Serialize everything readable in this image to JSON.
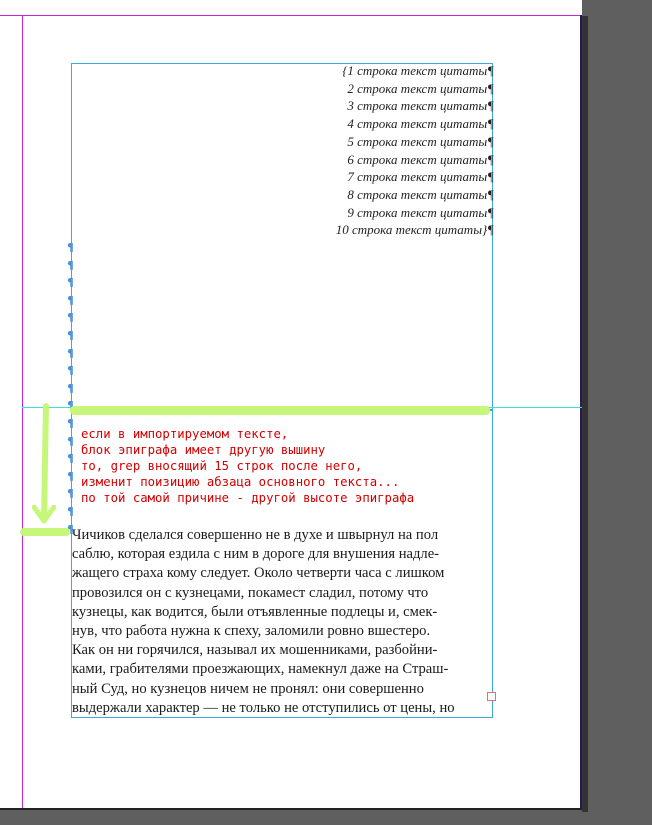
{
  "quote": {
    "lines": [
      "{1 строка текст цитаты¶",
      "2 строка текст цитаты¶",
      "3 строка текст цитаты¶",
      "4 строка текст цитаты¶",
      "5 строка текст цитаты¶",
      "6 строка текст цитаты¶",
      "7 строка текст цитаты¶",
      "8 строка текст цитаты¶",
      "9 строка текст цитаты¶",
      "10 строка текст цитаты}¶"
    ]
  },
  "pilcrows": [
    "¶",
    "¶",
    "¶",
    "¶",
    "¶",
    "¶",
    "¶",
    "¶",
    "¶",
    "¶",
    "¶",
    "¶",
    "¶",
    "¶",
    "¶",
    "¶",
    "¶"
  ],
  "annotation": {
    "lines": [
      "если в импортируемом тексте,",
      "блок эпиграфа имеет другую вышину",
      "то, grep вносящий 15 строк после него,",
      "изменит поизицию абзаца основного текста...",
      "по той самой причине - другой высоте эпиграфа"
    ],
    "color": "#d10000",
    "highlight_color": "#c6f77a"
  },
  "body": {
    "lines": [
      "Чичиков сделался совершенно не в духе и швырнул на пол",
      "саблю, которая ездила с ним в дороге для внушения надле-",
      "жащего страха кому следует. Около четверти часа с лишком",
      "провозился он с кузнецами, покамест сладил, потому что",
      "кузнецы, как водится, были отъявленные подлецы и, смек-",
      "нув, что работа нужна к спеху, заломили ровно вшестеро.",
      "Как он ни горячился, называл их мошенниками, разбойни-",
      "ками, грабителями проезжающих, намекнул даже на Страш-",
      "ный Суд, но кузнецов ничем не пронял: они совершенно",
      "выдержали характер — не только не отступились от цены, но"
    ]
  }
}
